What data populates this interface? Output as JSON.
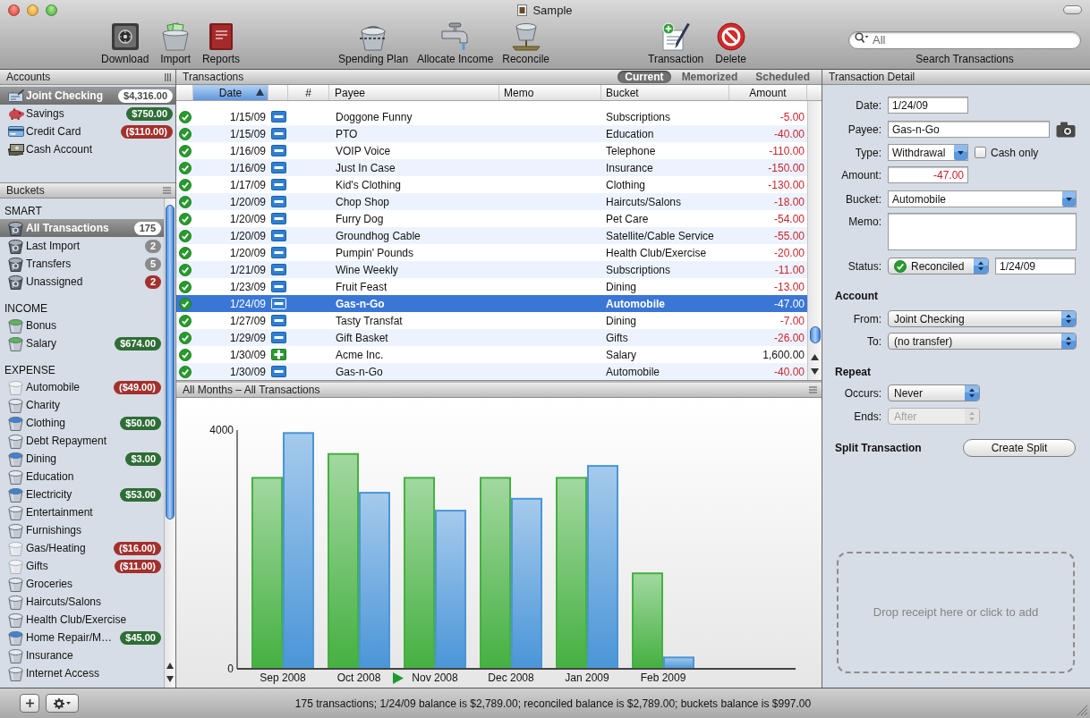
{
  "window": {
    "title": "Sample"
  },
  "toolbar": {
    "groups": [
      {
        "items": [
          {
            "label": "Download",
            "kind": "download"
          },
          {
            "label": "Import",
            "kind": "import"
          },
          {
            "label": "Reports",
            "kind": "reports"
          }
        ]
      },
      {
        "items": [
          {
            "label": "Spending Plan",
            "kind": "plan"
          },
          {
            "label": "Allocate Income",
            "kind": "allocate"
          },
          {
            "label": "Reconcile",
            "kind": "reconcile"
          }
        ]
      },
      {
        "items": [
          {
            "label": "Transaction",
            "kind": "transaction"
          },
          {
            "label": "Delete",
            "kind": "delete"
          }
        ]
      }
    ]
  },
  "search": {
    "placeholder": "All",
    "label": "Search Transactions"
  },
  "accounts": {
    "title": "Accounts",
    "items": [
      {
        "name": "Joint Checking",
        "kind": "checking",
        "balance": "$4,316.00",
        "color": "#ffffff",
        "selected": true
      },
      {
        "name": "Savings",
        "kind": "savings",
        "balance": "$750.00",
        "color": "#2f6d36",
        "selected": false
      },
      {
        "name": "Credit Card",
        "kind": "credit",
        "balance": "($110.00)",
        "color": "#a3302d",
        "selected": false
      },
      {
        "name": "Cash Account",
        "kind": "cash",
        "selected": false
      }
    ]
  },
  "buckets": {
    "title": "Buckets",
    "groups": [
      {
        "title": "SMART",
        "items": [
          {
            "name": "All Transactions",
            "kind": "smart",
            "badge": "175",
            "color": "#ffffff",
            "selected": true
          },
          {
            "name": "Last Import",
            "kind": "smart",
            "badge": "2",
            "color": "#8a8a8a",
            "selected": false
          },
          {
            "name": "Transfers",
            "kind": "smart",
            "badge": "5",
            "color": "#8a8a8a",
            "selected": false
          },
          {
            "name": "Unassigned",
            "kind": "smart",
            "badge": "2",
            "color": "#a3302d",
            "selected": false
          }
        ]
      },
      {
        "title": "INCOME",
        "items": [
          {
            "name": "Bonus",
            "kind": "income",
            "selected": false
          },
          {
            "name": "Salary",
            "kind": "income",
            "badge": "$674.00",
            "color": "#2f6d36",
            "selected": false
          }
        ]
      },
      {
        "title": "EXPENSE",
        "items": [
          {
            "name": "Automobile",
            "kind": "faded",
            "badge": "($49.00)",
            "color": "#a3302d",
            "selected": false
          },
          {
            "name": "Charity",
            "kind": "plain",
            "selected": false
          },
          {
            "name": "Clothing",
            "kind": "filled",
            "badge": "$50.00",
            "color": "#2f6d36",
            "selected": false
          },
          {
            "name": "Debt Repayment",
            "kind": "plain",
            "selected": false
          },
          {
            "name": "Dining",
            "kind": "filled",
            "badge": "$3.00",
            "color": "#2f6d36",
            "selected": false
          },
          {
            "name": "Education",
            "kind": "plain",
            "selected": false
          },
          {
            "name": "Electricity",
            "kind": "filled",
            "badge": "$53.00",
            "color": "#2f6d36",
            "selected": false
          },
          {
            "name": "Entertainment",
            "kind": "plain",
            "selected": false
          },
          {
            "name": "Furnishings",
            "kind": "plain",
            "selected": false
          },
          {
            "name": "Gas/Heating",
            "kind": "faded",
            "badge": "($16.00)",
            "color": "#a3302d",
            "selected": false
          },
          {
            "name": "Gifts",
            "kind": "faded",
            "badge": "($11.00)",
            "color": "#a3302d",
            "selected": false
          },
          {
            "name": "Groceries",
            "kind": "plain",
            "selected": false
          },
          {
            "name": "Haircuts/Salons",
            "kind": "plain",
            "selected": false
          },
          {
            "name": "Health Club/Exercise",
            "kind": "plain",
            "selected": false
          },
          {
            "name": "Home Repair/M…",
            "kind": "filled",
            "badge": "$45.00",
            "color": "#2f6d36",
            "selected": false
          },
          {
            "name": "Insurance",
            "kind": "plain",
            "selected": false
          },
          {
            "name": "Internet Access",
            "kind": "plain",
            "selected": false
          }
        ]
      }
    ]
  },
  "transactions": {
    "title": "Transactions",
    "tabs": [
      {
        "label": "Current",
        "selected": true
      },
      {
        "label": "Memorized",
        "selected": false
      },
      {
        "label": "Scheduled",
        "selected": false
      }
    ],
    "columns": [
      {
        "label": "Date",
        "selected": true,
        "sorted": true
      },
      {
        "label": "#",
        "selected": false,
        "sorted": false
      },
      {
        "label": "Payee",
        "selected": false,
        "sorted": false
      },
      {
        "label": "Memo",
        "selected": false,
        "sorted": false
      },
      {
        "label": "Bucket",
        "selected": false,
        "sorted": false
      },
      {
        "label": "Amount",
        "selected": false,
        "sorted": false
      }
    ],
    "rows": [
      {
        "reconciled": true,
        "date": "1/15/09",
        "kind": "withdrawal",
        "payee": "Doggone Funny",
        "bucket": "Subscriptions",
        "amount": "-5.00",
        "selected": false
      },
      {
        "reconciled": true,
        "date": "1/15/09",
        "kind": "withdrawal",
        "payee": "PTO",
        "bucket": "Education",
        "amount": "-40.00",
        "selected": false
      },
      {
        "reconciled": true,
        "date": "1/16/09",
        "kind": "withdrawal",
        "payee": "VOIP Voice",
        "bucket": "Telephone",
        "amount": "-110.00",
        "selected": false
      },
      {
        "reconciled": true,
        "date": "1/16/09",
        "kind": "withdrawal",
        "payee": "Just In Case",
        "bucket": "Insurance",
        "amount": "-150.00",
        "selected": false
      },
      {
        "reconciled": true,
        "date": "1/17/09",
        "kind": "withdrawal",
        "payee": "Kid's Clothing",
        "bucket": "Clothing",
        "amount": "-130.00",
        "selected": false
      },
      {
        "reconciled": true,
        "date": "1/20/09",
        "kind": "withdrawal",
        "payee": "Chop Shop",
        "bucket": "Haircuts/Salons",
        "amount": "-18.00",
        "selected": false
      },
      {
        "reconciled": true,
        "date": "1/20/09",
        "kind": "withdrawal",
        "payee": "Furry Dog",
        "bucket": "Pet Care",
        "amount": "-54.00",
        "selected": false
      },
      {
        "reconciled": true,
        "date": "1/20/09",
        "kind": "withdrawal",
        "payee": "Groundhog Cable",
        "bucket": "Satellite/Cable Service",
        "amount": "-55.00",
        "selected": false
      },
      {
        "reconciled": true,
        "date": "1/20/09",
        "kind": "withdrawal",
        "payee": "Pumpin' Pounds",
        "bucket": "Health Club/Exercise",
        "amount": "-20.00",
        "selected": false
      },
      {
        "reconciled": true,
        "date": "1/21/09",
        "kind": "withdrawal",
        "payee": "Wine Weekly",
        "bucket": "Subscriptions",
        "amount": "-11.00",
        "selected": false
      },
      {
        "reconciled": true,
        "date": "1/23/09",
        "kind": "withdrawal",
        "payee": "Fruit Feast",
        "bucket": "Dining",
        "amount": "-13.00",
        "selected": false
      },
      {
        "reconciled": true,
        "date": "1/24/09",
        "kind": "withdrawal",
        "payee": "Gas-n-Go",
        "bucket": "Automobile",
        "amount": "-47.00",
        "selected": true
      },
      {
        "reconciled": true,
        "date": "1/27/09",
        "kind": "withdrawal",
        "payee": "Tasty Transfat",
        "bucket": "Dining",
        "amount": "-7.00",
        "selected": false
      },
      {
        "reconciled": true,
        "date": "1/29/09",
        "kind": "withdrawal",
        "payee": "Gift Basket",
        "bucket": "Gifts",
        "amount": "-26.00",
        "selected": false
      },
      {
        "reconciled": true,
        "date": "1/30/09",
        "kind": "deposit",
        "payee": "Acme Inc.",
        "bucket": "Salary",
        "amount": "1,600.00",
        "selected": false
      },
      {
        "reconciled": true,
        "date": "1/30/09",
        "kind": "withdrawal",
        "payee": "Gas-n-Go",
        "bucket": "Automobile",
        "amount": "-40.00",
        "selected": false
      }
    ]
  },
  "chart": {
    "title": "All Months – All Transactions",
    "chart_data": {
      "type": "bar",
      "categories": [
        "Sep 2008",
        "Oct 2008",
        "Nov 2008",
        "Dec 2008",
        "Jan 2009",
        "Feb 2009"
      ],
      "series": [
        {
          "color": "#45b041",
          "values": [
            3200,
            3600,
            3200,
            3200,
            3200,
            1600
          ]
        },
        {
          "color": "#4a95d8",
          "values": [
            3950,
            2950,
            2650,
            2850,
            3400,
            190
          ]
        }
      ],
      "ylim": [
        0,
        4000
      ],
      "yticks": [
        0,
        4000
      ]
    }
  },
  "detail": {
    "title": "Transaction Detail",
    "date": {
      "label": "Date:",
      "value": "1/24/09"
    },
    "payee": {
      "label": "Payee:",
      "value": "Gas-n-Go"
    },
    "type": {
      "label": "Type:",
      "value": "Withdrawal"
    },
    "cash_only": {
      "label": "Cash only",
      "checked": false
    },
    "amount": {
      "label": "Amount:",
      "value": "-47.00",
      "negative": true
    },
    "bucket": {
      "label": "Bucket:",
      "value": "Automobile"
    },
    "memo": {
      "label": "Memo:"
    },
    "status": {
      "label": "Status:",
      "value": "Reconciled",
      "reconciled": true,
      "date": "1/24/09"
    },
    "account": {
      "title": "Account",
      "from": {
        "label": "From:",
        "value": "Joint Checking"
      },
      "to": {
        "label": "To:",
        "value": "(no transfer)"
      }
    },
    "repeat": {
      "title": "Repeat",
      "occurs": {
        "label": "Occurs:",
        "value": "Never"
      },
      "ends": {
        "label": "Ends:",
        "value": "After",
        "disabled": true
      }
    },
    "split": {
      "title": "Split Transaction",
      "button": "Create Split"
    },
    "receipt": {
      "text": "Drop receipt here or click to add"
    }
  },
  "status_bar": {
    "text": "175 transactions; 1/24/09 balance is $2,789.00; reconciled balance is $2,789.00; buckets balance is $997.00"
  }
}
